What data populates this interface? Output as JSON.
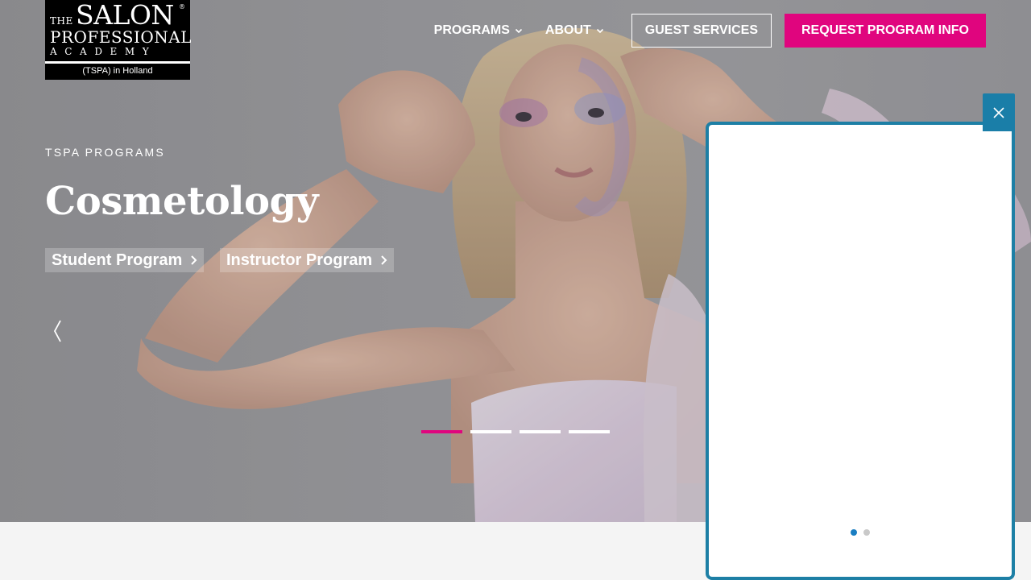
{
  "logo": {
    "the": "THE",
    "salon": "SALON",
    "registered": "®",
    "professional": "PROFESSIONAL",
    "academy": "ACADEMY",
    "location": "(TSPA) in Holland"
  },
  "nav": {
    "programs": "PROGRAMS",
    "about": "ABOUT",
    "guest_services": "GUEST SERVICES",
    "request_info": "REQUEST PROGRAM INFO"
  },
  "hero": {
    "eyebrow": "TSPA PROGRAMS",
    "headline": "Cosmetology",
    "buttons": [
      "Student Program",
      "Instructor Program"
    ],
    "slide_count": 4,
    "active_slide": 1
  },
  "popup": {
    "page_count": 2,
    "active_page": 1
  },
  "colors": {
    "accent_pink": "#e0057e",
    "popup_blue": "#1d7fa5",
    "popup_close_blue": "#1a7ea8",
    "page_bg": "#f4f4f4"
  },
  "icons": {
    "nav_chevron": "chevron-down-icon",
    "pill_arrow": "chevron-right-icon",
    "slider_prev": "chevron-left-icon",
    "popup_close": "close-icon"
  }
}
